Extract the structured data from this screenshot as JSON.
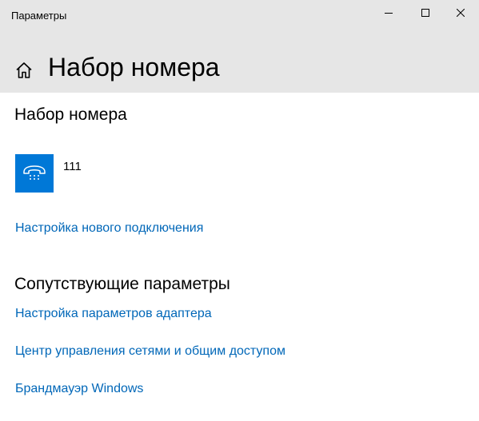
{
  "window": {
    "title": "Параметры"
  },
  "header": {
    "title": "Набор номера"
  },
  "dialup_section": {
    "title": "Набор номера",
    "connections": [
      {
        "name": "111",
        "icon": "dialup-phone-icon"
      }
    ],
    "setup_link": "Настройка нового подключения"
  },
  "related_section": {
    "title": "Сопутствующие параметры",
    "links": [
      "Настройка параметров адаптера",
      "Центр управления сетями и общим доступом",
      "Брандмауэр Windows"
    ]
  },
  "colors": {
    "accent": "#0078d7",
    "link": "#0067b8",
    "header_bg": "#e6e6e6"
  }
}
